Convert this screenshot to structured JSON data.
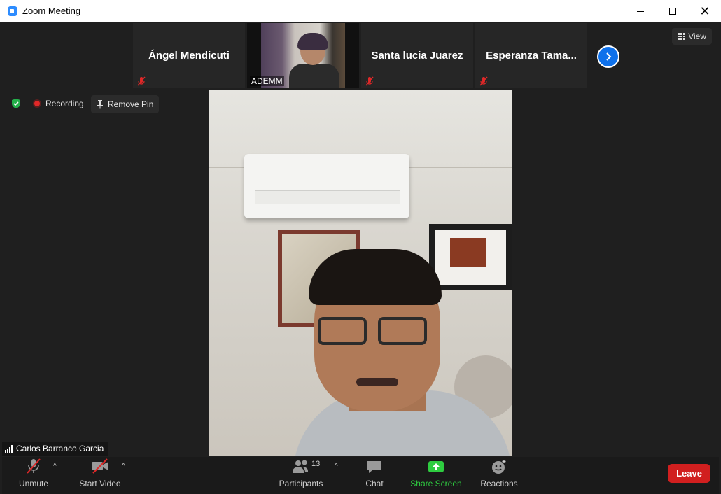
{
  "window": {
    "title": "Zoom Meeting",
    "icon": "zoom-app-icon"
  },
  "thumbnails": [
    {
      "name": "Ángel Mendicuti",
      "muted": true,
      "video": false
    },
    {
      "name": "ADEMM",
      "muted": false,
      "video": true
    },
    {
      "name": "Santa lucia Juarez",
      "muted": true,
      "video": false
    },
    {
      "name": "Esperanza  Tama...",
      "muted": true,
      "video": false
    }
  ],
  "header": {
    "view_label": "View"
  },
  "status": {
    "recording_label": "Recording",
    "remove_pin_label": "Remove Pin"
  },
  "main_video": {
    "speaker_name": "Carlos Barranco Garcia"
  },
  "toolbar": {
    "unmute_label": "Unmute",
    "start_video_label": "Start Video",
    "participants_label": "Participants",
    "participants_count": "13",
    "chat_label": "Chat",
    "share_screen_label": "Share Screen",
    "reactions_label": "Reactions",
    "leave_label": "Leave"
  },
  "colors": {
    "accent_blue": "#0e71eb",
    "share_green": "#2ecc40",
    "leave_red": "#d11f1f",
    "muted_red": "#e02828"
  }
}
